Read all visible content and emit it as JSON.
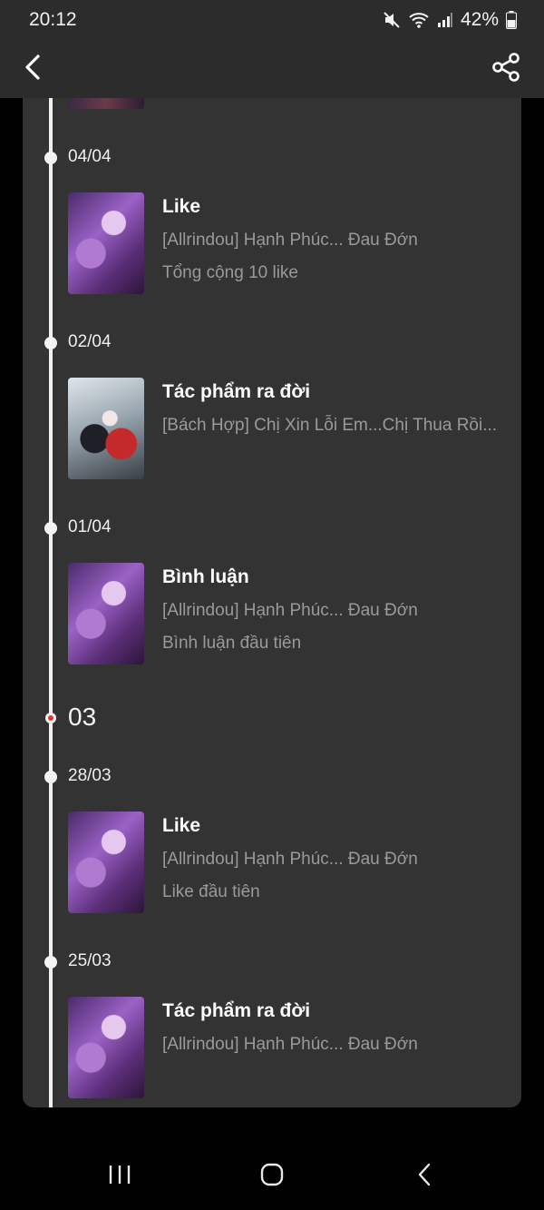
{
  "status": {
    "time": "20:12",
    "battery": "42%"
  },
  "appbar": {
    "back_icon": "chevron-left-icon",
    "share_icon": "share-icon"
  },
  "timeline": {
    "month": "03",
    "entries": [
      {
        "date": "04/04",
        "title": "Like",
        "work": "[Allrindou] Hạnh Phúc... Đau Đớn",
        "detail": "Tổng cộng 10 like",
        "thumb": "purple"
      },
      {
        "date": "02/04",
        "title": "Tác phẩm ra đời",
        "work": "[Bách Hợp] Chị Xin Lỗi Em...Chị Thua Rồi...",
        "detail": "",
        "thumb": "winter"
      },
      {
        "date": "01/04",
        "title": "Bình luận",
        "work": "[Allrindou] Hạnh Phúc... Đau Đớn",
        "detail": "Bình luận đầu tiên",
        "thumb": "purple"
      },
      {
        "date": "28/03",
        "title": "Like",
        "work": "[Allrindou] Hạnh Phúc... Đau Đớn",
        "detail": "Like đầu tiên",
        "thumb": "purple"
      },
      {
        "date": "25/03",
        "title": "Tác phẩm ra đời",
        "work": "[Allrindou] Hạnh Phúc... Đau Đớn",
        "detail": "",
        "thumb": "purple"
      }
    ]
  },
  "navbar": {
    "recents_icon": "recents-icon",
    "home_icon": "home-icon",
    "back_icon": "back-icon"
  }
}
